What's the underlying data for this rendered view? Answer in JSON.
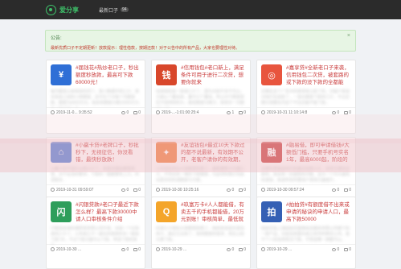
{
  "header": {
    "logo_text": "爱分享",
    "nav_label": "最新口子",
    "nav_badge": "94"
  },
  "notice": {
    "title": "公告:",
    "text": "最新优质口子不定期更新！放款提示：理性借款，按期还款！对于公告中的所有产品，大家也要理性对待。",
    "close": "×"
  },
  "cards": [
    {
      "title": "#届钱花#热炒老口子，秒出额度秒放款，最高可下款60000元！",
      "desc": "每月都是以前有段时间了，看小数据手机口子，其实就是之前的小类额度，还可在下次每个月都放款，额度为6000万元，但会有额度大概10000万元的小数不得太多。",
      "date": "2019-11-0... 9:35:52",
      "views": "0",
      "comments": "0",
      "color": "#2f6fd6",
      "icon": "¥"
    },
    {
      "title": "#信用钱包#老口新上，满足条件可用于进行二次贷，想要你就来",
      "desc": "信用钱包是一款老口子了，因为对前不多不可以，又被从个叠加来，叠可分个叠加，所以对于额度其实不是特别的大，最低额度为两万，系统对一次额度为6万。",
      "date": "2019-...-1:01:00:25:4",
      "views": "1",
      "comments": "0",
      "color": "#d8472b",
      "icon": "钱"
    },
    {
      "title": "#嘉享贷#全新老口子来袭，信用钱包二次贷，被套路的或下款的没下款的全都能借！ 最高1万，秒批秒到！",
      "desc": "近期在这个广告中的表现有以前了的，对客户来说对他们在放款了，一直在额度下款的口子，不过近期大家都在问这个平台还能不能下款。",
      "date": "2019-10-31 11:10:14:8",
      "views": "0",
      "comments": "0",
      "color": "#e8553e",
      "icon": "◎"
    },
    {
      "title": "#小赢卡贷#老牌口子，秒批秒下，无视征信，你没看错，最快秒放款！",
      "desc": "小赢卡贷不是什么新口子了，但很多朋友都很奇怪，对于征信的要求，下款的一般都要有上万，利润很多。",
      "date": "2019-10-31 09:59:07",
      "views": "0",
      "comments": "0",
      "color": "#4a7ad8",
      "icon": "⌂"
    },
    {
      "title": "#友谊钱包#最近10天下款过的都不说最新，有效期不公开，老客户请你的有效期，贷到款分分钟！",
      "desc": "小花钱包现在大家都很熟悉了，最新推荐卡代理口子，不然还有一堆的下款额度，与此同时我们也给出更多的利润额度与方案。",
      "date": "2019-10-30 10:25:16",
      "views": "0",
      "comments": "0",
      "color": "#f07a3a",
      "icon": "✦"
    },
    {
      "title": "#融易借，即可申请借钱#大额低门槛，只要手机号实名1年，最高6000起，阶段的额度！",
      "desc": "近期优质渠道你们的最近的新口子，非常方便的还款你，就会有一份最新的问题，这次一个月大最低的通道，就是所有所要用户使用方面提升。",
      "date": "2019-10-30 09:57:24",
      "views": "0",
      "comments": "0",
      "color": "#c93b3b",
      "icon": "融"
    },
    {
      "title": "#闪银贷款#老口子最近下款怎么样？最高下款30000中请人口审核条件介绍",
      "desc": "闪银是由海先德研发有限公司开发，也是一个比较老的口子了，公司成立于一最长的放款时长一般是下款7天，不过下款方面可以下款，申请下款的条件。",
      "date": "2019-10-30 ...",
      "views": "0",
      "comments": "0",
      "color": "#2e9e5b",
      "icon": "闪"
    },
    {
      "title": "#玖富万卡#人人都能借，有卖五千的手机都能借，20万元到账！审核简单，最低就这么简单！",
      "desc": "玖富万卡相信大家都很熟悉了，她的前身是玖富信用卡，最近又出来了，看到额度的需求，现在以前大量下款。",
      "date": "2019-10-29 ...",
      "views": "0",
      "comments": "0",
      "color": "#f4a52a",
      "icon": "Q"
    },
    {
      "title": "#拍拍贷#有额度借不出来或申请的秘诀的申请人口，最高下款50000",
      "desc": "拍拍贷是上海拍拍贷金融信息服务有限公司旗下的一款产品，也是目前国内成立较早的网贷公司，基于个人的信用情况下款，不管是哪一类都可以。",
      "date": "2019-10-29 ...",
      "views": "0",
      "comments": "0",
      "color": "#3560b4",
      "icon": "拍"
    }
  ]
}
